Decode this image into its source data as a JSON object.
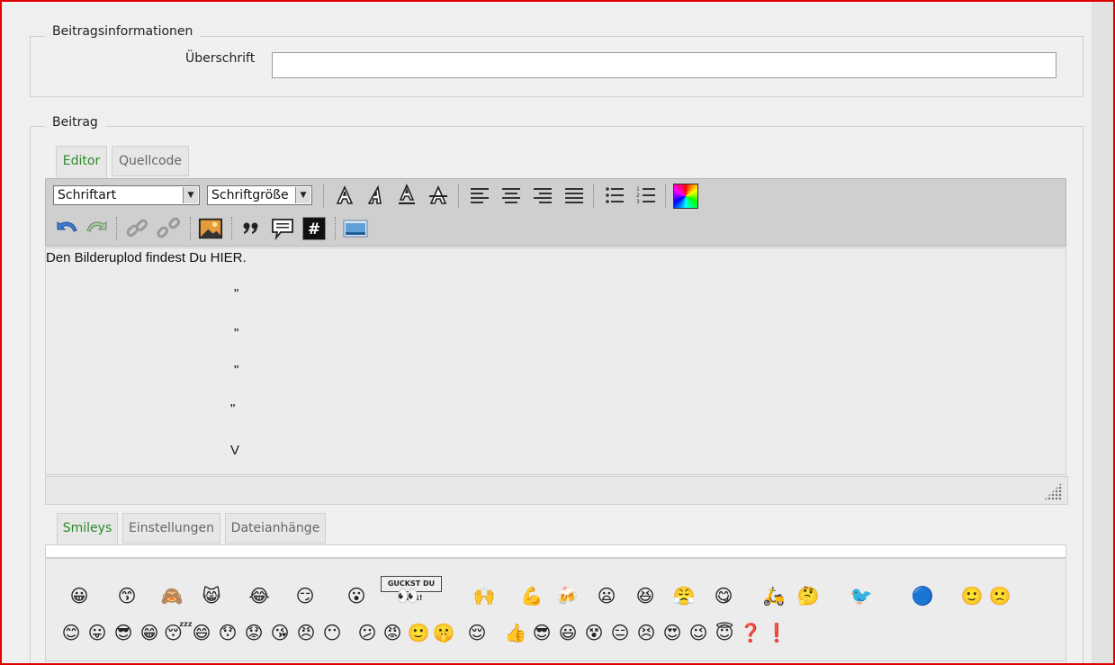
{
  "post_info": {
    "legend": "Beitragsinformationen",
    "subject_label": "Überschrift",
    "subject_value": ""
  },
  "post": {
    "legend": "Beitrag",
    "tabs": [
      {
        "label": "Editor",
        "active": true
      },
      {
        "label": "Quellcode",
        "active": false
      }
    ]
  },
  "toolbar": {
    "font_select": "Schriftart",
    "size_select": "Schriftgröße",
    "row1_icons": [
      "bold-icon",
      "italic-icon",
      "underline-icon",
      "strikethrough-icon",
      "align-left-icon",
      "align-center-icon",
      "align-right-icon",
      "align-justify-icon",
      "bullet-list-icon",
      "numbered-list-icon",
      "color-picker-icon"
    ],
    "row2_icons": [
      "undo-icon",
      "redo-icon",
      "link-icon",
      "unlink-icon",
      "image-icon",
      "quote-icon",
      "speech-bubble-icon",
      "code-icon",
      "media-icon"
    ]
  },
  "editor": {
    "lines": [
      "Den Bilderuplod findest Du HIER.",
      "\"",
      "\"",
      "\"",
      "\"",
      "V"
    ]
  },
  "bottom_tabs": [
    {
      "label": "Smileys",
      "active": true
    },
    {
      "label": "Einstellungen",
      "active": false
    },
    {
      "label": "Dateianhänge",
      "active": false
    }
  ],
  "smileys": {
    "sign_text": "GUCKST DU HIER!",
    "row1": [
      "😀",
      "😙",
      "🙈",
      "😸",
      "😂",
      "😏",
      "😮",
      "👀",
      "🙌",
      "💪",
      "🍻",
      "😦",
      "😆",
      "😤",
      "😋",
      "🛵",
      "🤔",
      "🐦",
      "🔵",
      "🙂",
      "🙁"
    ],
    "row2": [
      "😊",
      "😛",
      "😎",
      "😁",
      "😴",
      "😄",
      "😯",
      "😟",
      "😘",
      "😠",
      "😶",
      "😕",
      "😡",
      "🙂",
      "🤫",
      "😌",
      "👍",
      "😎",
      "😃",
      "😵",
      "😑",
      "😣",
      "😍",
      "😉",
      "😇",
      "❓",
      "❗"
    ]
  },
  "colors": {
    "frame": "#e00000",
    "active_tab_text": "#2a8a2a",
    "toolbar_bg": "#cfcfcf"
  }
}
